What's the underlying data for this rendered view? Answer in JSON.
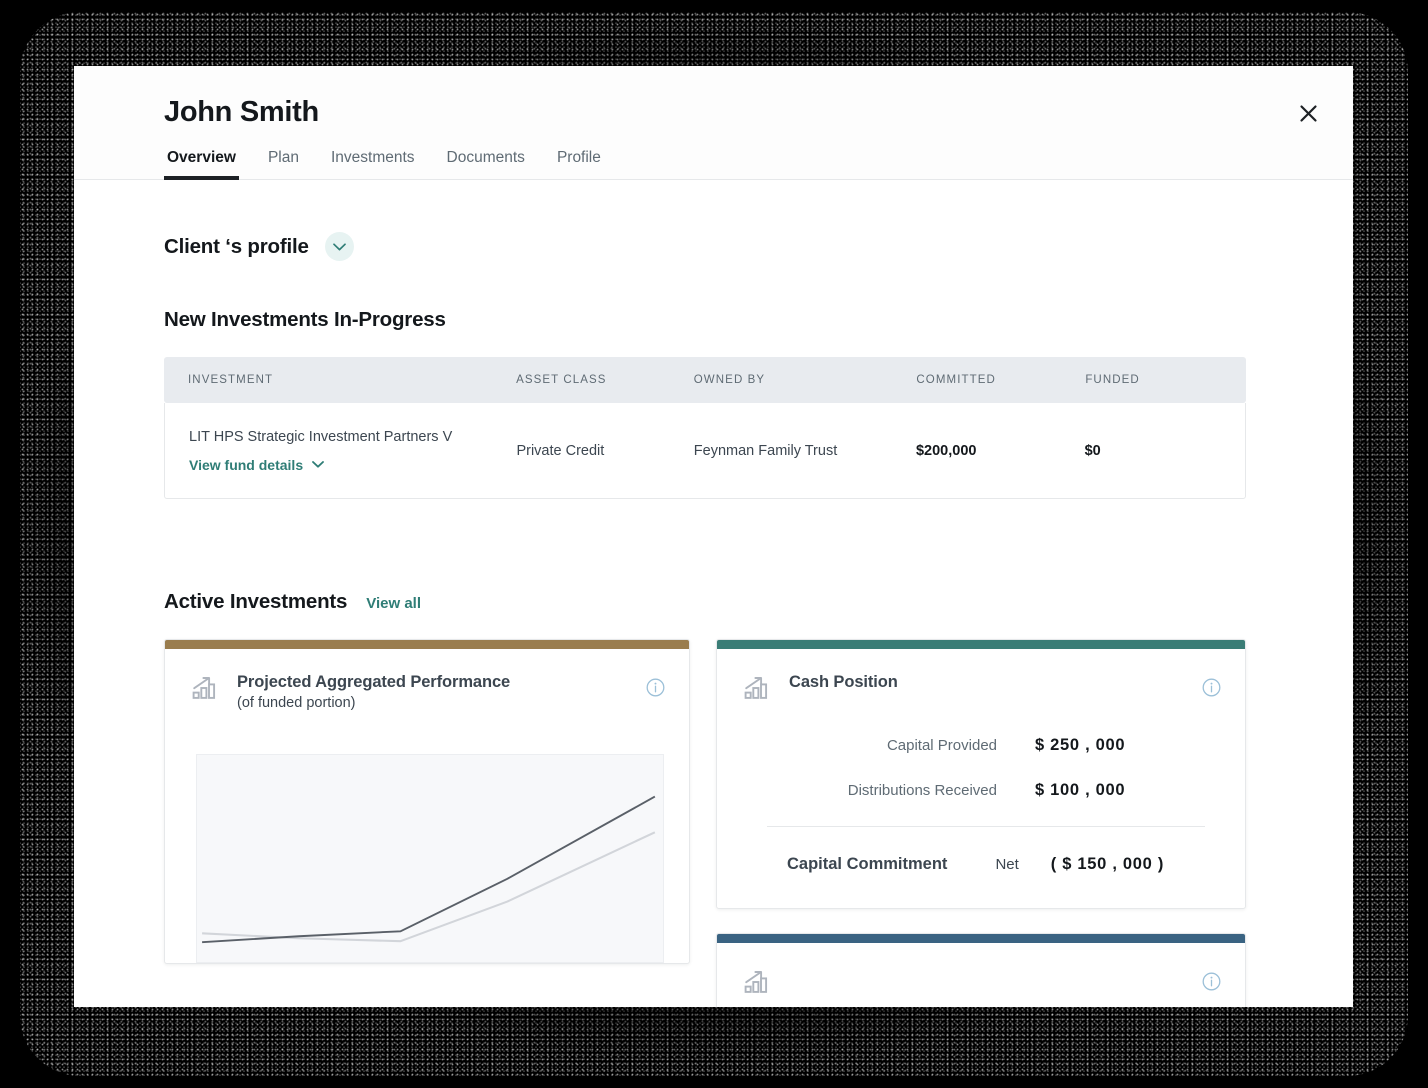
{
  "modal": {
    "title": "John Smith",
    "close_icon": "close-icon"
  },
  "tabs": [
    {
      "label": "Overview",
      "active": true
    },
    {
      "label": "Plan",
      "active": false
    },
    {
      "label": "Investments",
      "active": false
    },
    {
      "label": "Documents",
      "active": false
    },
    {
      "label": "Profile",
      "active": false
    }
  ],
  "client_profile": {
    "label": "Client ‘s profile",
    "toggle_icon": "chevron-down-icon"
  },
  "new_investments": {
    "heading": "New Investments In-Progress",
    "columns": [
      "INVESTMENT",
      "ASSET CLASS",
      "OWNED BY",
      "COMMITTED",
      "FUNDED"
    ],
    "rows": [
      {
        "investment": "LIT HPS Strategic Investment Partners V",
        "fund_details_link": "View fund details",
        "asset_class": "Private Credit",
        "owned_by": "Feynman Family Trust",
        "committed": "$200,000",
        "funded": "$0"
      }
    ]
  },
  "active_investments": {
    "heading": "Active Investments",
    "view_all": "View all",
    "cards": [
      {
        "accent_color": "#9a7d4e",
        "icon": "bar-chart-arrow-icon",
        "title": "Projected Aggregated Performance",
        "subtitle": "(of funded portion)",
        "info_icon": "info-icon"
      },
      {
        "accent_color": "#3a7d76",
        "icon": "bar-chart-arrow-icon",
        "title": "Cash Position",
        "info_icon": "info-icon",
        "rows": [
          {
            "label": "Capital Provided",
            "value": "$ 250 , 000"
          },
          {
            "label": "Distributions Received",
            "value": "$ 100 , 000"
          }
        ],
        "total": {
          "label": "Capital Commitment",
          "qualifier": "Net",
          "value": "( $ 150 , 000 )"
        }
      },
      {
        "accent_color": "#3a6382",
        "icon": "bar-chart-arrow-icon",
        "title": "",
        "info_icon": "info-icon"
      }
    ]
  },
  "chart_data": {
    "type": "line",
    "title": "Projected Aggregated Performance",
    "subtitle": "(of funded portion)",
    "xlabel": "",
    "ylabel": "",
    "grid": false,
    "legend": "none",
    "x": [
      0,
      1,
      2,
      3,
      4
    ],
    "series": [
      {
        "name": "projected-dark",
        "color": "#5a6068",
        "values": [
          8,
          13,
          16,
          56,
          88
        ]
      },
      {
        "name": "projected-light",
        "color": "#d2d5da",
        "values": [
          13,
          14,
          14,
          42,
          76
        ]
      }
    ],
    "ylim": [
      0,
      100
    ],
    "xlim": [
      0,
      4
    ]
  },
  "colors": {
    "accent_teal": "#2f7d76",
    "accent_bronze": "#9a7d4e",
    "accent_blue": "#3a6382",
    "text_primary": "#14181c",
    "text_muted": "#5f6b74",
    "info_icon": "#9cc0d8",
    "table_header_bg": "#e8ebef"
  }
}
